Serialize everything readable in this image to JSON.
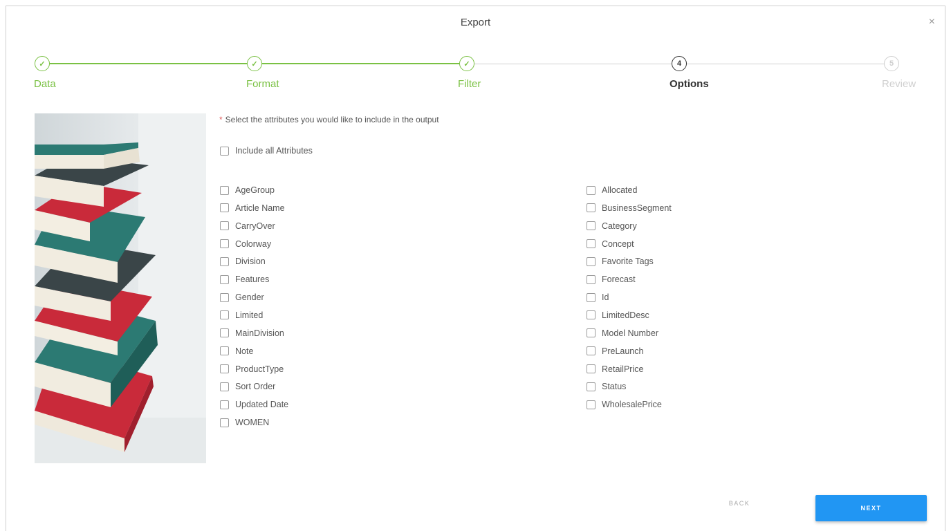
{
  "dialog": {
    "title": "Export",
    "close_symbol": "×"
  },
  "stepper": {
    "steps": [
      {
        "label": "Data",
        "marker": "✓",
        "state": "done"
      },
      {
        "label": "Format",
        "marker": "✓",
        "state": "done"
      },
      {
        "label": "Filter",
        "marker": "✓",
        "state": "done"
      },
      {
        "label": "Options",
        "marker": "4",
        "state": "active"
      },
      {
        "label": "Review",
        "marker": "5",
        "state": "todo"
      }
    ]
  },
  "main": {
    "required_marker": "*",
    "instruction": "Select the attributes you would like to include in the output",
    "include_all_label": "Include all Attributes",
    "left_attributes": [
      "AgeGroup",
      "Article Name",
      "CarryOver",
      "Colorway",
      "Division",
      "Features",
      "Gender",
      "Limited",
      "MainDivision",
      "Note",
      "ProductType",
      "Sort Order",
      "Updated Date",
      "WOMEN"
    ],
    "right_attributes": [
      "Allocated",
      "BusinessSegment",
      "Category",
      "Concept",
      "Favorite Tags",
      "Forecast",
      "Id",
      "LimitedDesc",
      "Model Number",
      "PreLaunch",
      "RetailPrice",
      "Status",
      "WholesalePrice"
    ]
  },
  "footer": {
    "back_label": "BACK",
    "next_label": "NEXT"
  },
  "colors": {
    "accent_green": "#7ac143",
    "primary_blue": "#2196f3",
    "required_red": "#e05a5a"
  }
}
